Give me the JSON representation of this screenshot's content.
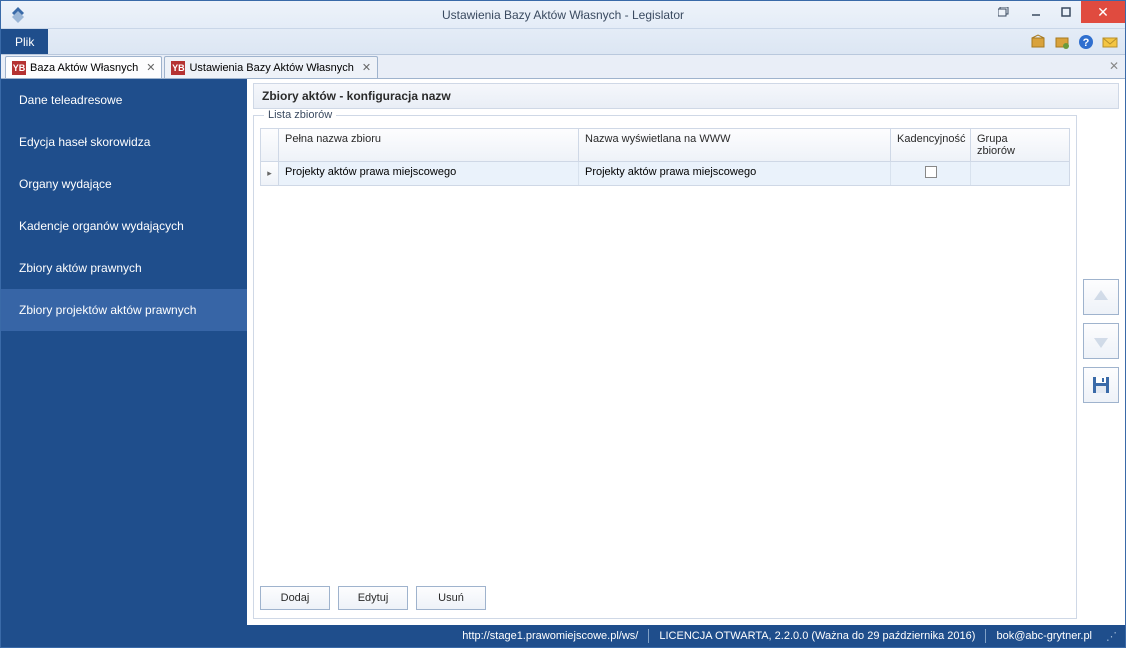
{
  "window": {
    "title": "Ustawienia Bazy Aktów Własnych - Legislator"
  },
  "menu": {
    "file": "Plik"
  },
  "tabs": [
    {
      "label": "Baza Aktów Własnych",
      "active": true
    },
    {
      "label": "Ustawienia Bazy Aktów Własnych",
      "active": false
    }
  ],
  "sidebar": {
    "items": [
      {
        "label": "Dane teleadresowe"
      },
      {
        "label": "Edycja haseł skorowidza"
      },
      {
        "label": "Organy wydające"
      },
      {
        "label": "Kadencje organów wydających"
      },
      {
        "label": "Zbiory aktów prawnych"
      },
      {
        "label": "Zbiory projektów aktów prawnych"
      }
    ],
    "activeIndex": 5
  },
  "section": {
    "header": "Zbiory aktów - konfiguracja nazw",
    "fieldset_legend": "Lista zbiorów"
  },
  "grid": {
    "columns": [
      "Pełna nazwa zbioru",
      "Nazwa wyświetlana na WWW",
      "Kadencyjność",
      "Grupa zbiorów"
    ],
    "rows": [
      {
        "full_name": "Projekty aktów prawa miejscowego",
        "www_name": "Projekty aktów prawa miejscowego",
        "cadence_checked": false,
        "group": ""
      }
    ]
  },
  "buttons": {
    "add": "Dodaj",
    "edit": "Edytuj",
    "delete": "Usuń"
  },
  "status": {
    "url": "http://stage1.prawomiejscowe.pl/ws/",
    "license": "LICENCJA OTWARTA, 2.2.0.0 (Ważna do 29 października 2016)",
    "email": "bok@abc-grytner.pl"
  },
  "icons": {
    "tab_badge": "YB"
  }
}
